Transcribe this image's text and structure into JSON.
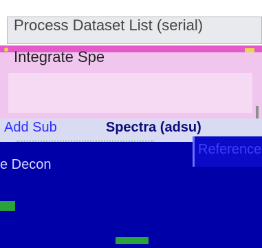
{
  "header": {
    "title": "Process Dataset List (serial)"
  },
  "panels": {
    "integrate_label": "Integrate Spe",
    "addsub_label_light": "Add Sub",
    "addsub_label_bold": "Spectra (adsu)",
    "reference_label": "Reference",
    "deconvolve_label": "e Decon"
  },
  "colors": {
    "pink_panel": "#f0c6ee",
    "accent_magenta": "#e55ac9",
    "blue_band": "#0000a8",
    "highlight_blue": "#2d2dff"
  }
}
